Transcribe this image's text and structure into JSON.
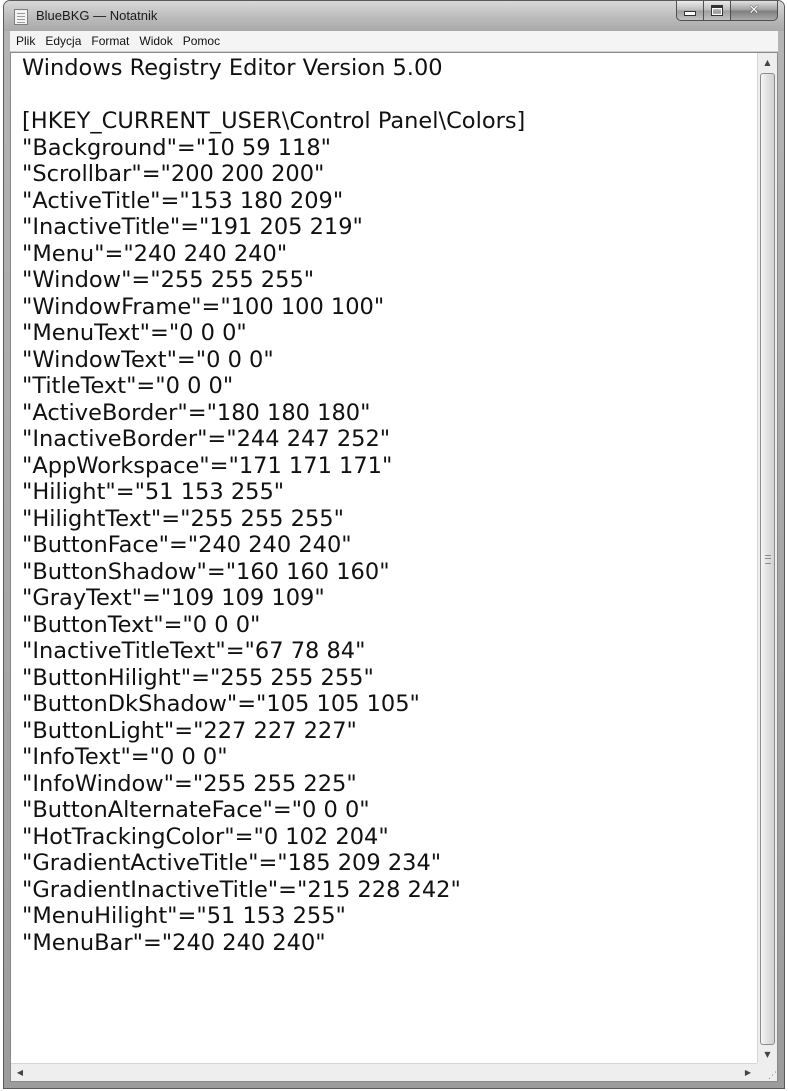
{
  "window": {
    "title": "BlueBKG — Notatnik"
  },
  "menubar": {
    "items": [
      "Plik",
      "Edycja",
      "Format",
      "Widok",
      "Pomoc"
    ]
  },
  "editor": {
    "lines": [
      "Windows Registry Editor Version 5.00",
      "",
      "[HKEY_CURRENT_USER\\Control Panel\\Colors]",
      "\"Background\"=\"10 59 118\"",
      "\"Scrollbar\"=\"200 200 200\"",
      "\"ActiveTitle\"=\"153 180 209\"",
      "\"InactiveTitle\"=\"191 205 219\"",
      "\"Menu\"=\"240 240 240\"",
      "\"Window\"=\"255 255 255\"",
      "\"WindowFrame\"=\"100 100 100\"",
      "\"MenuText\"=\"0 0 0\"",
      "\"WindowText\"=\"0 0 0\"",
      "\"TitleText\"=\"0 0 0\"",
      "\"ActiveBorder\"=\"180 180 180\"",
      "\"InactiveBorder\"=\"244 247 252\"",
      "\"AppWorkspace\"=\"171 171 171\"",
      "\"Hilight\"=\"51 153 255\"",
      "\"HilightText\"=\"255 255 255\"",
      "\"ButtonFace\"=\"240 240 240\"",
      "\"ButtonShadow\"=\"160 160 160\"",
      "\"GrayText\"=\"109 109 109\"",
      "\"ButtonText\"=\"0 0 0\"",
      "\"InactiveTitleText\"=\"67 78 84\"",
      "\"ButtonHilight\"=\"255 255 255\"",
      "\"ButtonDkShadow\"=\"105 105 105\"",
      "\"ButtonLight\"=\"227 227 227\"",
      "\"InfoText\"=\"0 0 0\"",
      "\"InfoWindow\"=\"255 255 225\"",
      "\"ButtonAlternateFace\"=\"0 0 0\"",
      "\"HotTrackingColor\"=\"0 102 204\"",
      "\"GradientActiveTitle\"=\"185 209 234\"",
      "\"GradientInactiveTitle\"=\"215 228 242\"",
      "\"MenuHilight\"=\"51 153 255\"",
      "\"MenuBar\"=\"240 240 240\""
    ]
  },
  "icons": {
    "app": "notepad-icon",
    "minimize": "minimize-icon",
    "maximize": "maximize-icon",
    "close": "close-icon",
    "scroll_up": "scroll-up-arrow-icon",
    "scroll_down": "scroll-down-arrow-icon",
    "scroll_left": "scroll-left-arrow-icon",
    "scroll_right": "scroll-right-arrow-icon"
  }
}
